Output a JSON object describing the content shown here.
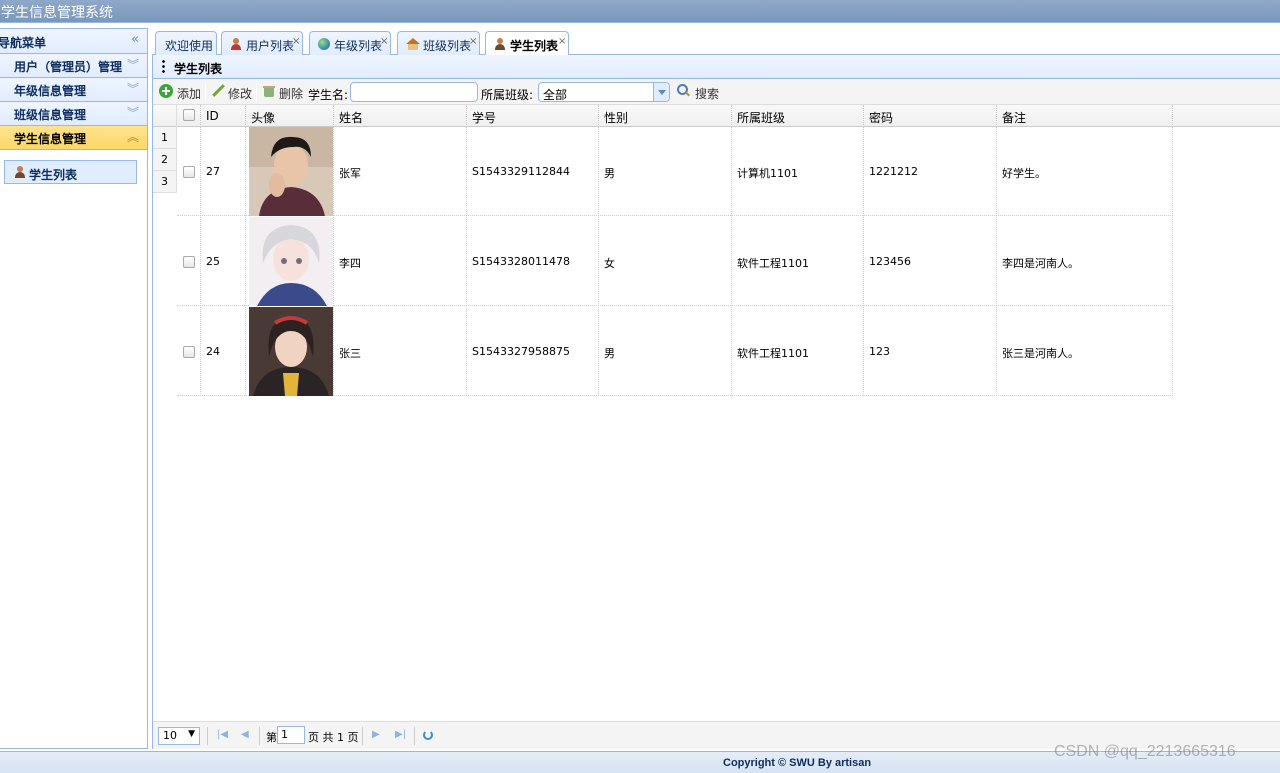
{
  "app": {
    "title": "学生信息管理系统"
  },
  "sidebar": {
    "header": "导航菜单",
    "items": [
      {
        "label": "用户（管理员）管理",
        "active": false
      },
      {
        "label": "年级信息管理",
        "active": false
      },
      {
        "label": "班级信息管理",
        "active": false
      },
      {
        "label": "学生信息管理",
        "active": true
      }
    ],
    "sub_item": "学生列表"
  },
  "tabs": [
    {
      "label": "欢迎使用",
      "closable": false
    },
    {
      "label": "用户列表",
      "closable": true
    },
    {
      "label": "年级列表",
      "closable": true
    },
    {
      "label": "班级列表",
      "closable": true
    },
    {
      "label": "学生列表",
      "closable": true,
      "active": true
    }
  ],
  "panel": {
    "title": "学生列表"
  },
  "toolbar": {
    "add": "添加",
    "edit": "修改",
    "delete": "删除",
    "name_label": "学生名:",
    "name_value": "",
    "class_label": "所属班级:",
    "class_value": "全部",
    "search": "搜索"
  },
  "grid": {
    "columns": [
      "ID",
      "头像",
      "姓名",
      "学号",
      "性别",
      "所属班级",
      "密码",
      "备注"
    ],
    "rows": [
      {
        "num": "1",
        "id": "27",
        "name": "张军",
        "sn": "S1543329112844",
        "sex": "男",
        "class": "计算机1101",
        "password": "1221212",
        "remark": "好学生。"
      },
      {
        "num": "2",
        "id": "25",
        "name": "李四",
        "sn": "S1543328011478",
        "sex": "女",
        "class": "软件工程1101",
        "password": "123456",
        "remark": "李四是河南人。"
      },
      {
        "num": "3",
        "id": "24",
        "name": "张三",
        "sn": "S1543327958875",
        "sex": "男",
        "class": "软件工程1101",
        "password": "123",
        "remark": "张三是河南人。"
      }
    ]
  },
  "pager": {
    "page_size": "10",
    "page_prefix": "第",
    "page_value": "1",
    "page_suffix": "页 共 1 页"
  },
  "footer": {
    "copyright": "Copyright © SWU By artisan"
  },
  "watermark": "CSDN @qq_2213665316"
}
